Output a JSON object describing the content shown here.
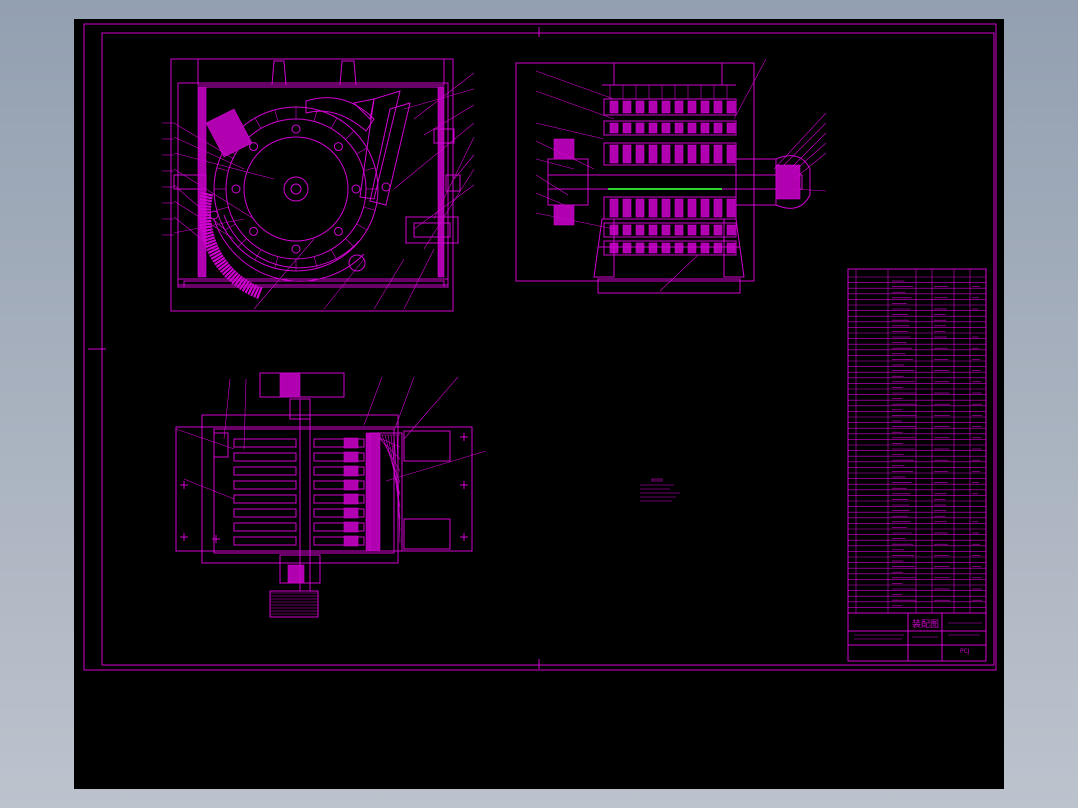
{
  "title_block": {
    "assembly_title": "装配图",
    "drawing_code": "PCJ"
  },
  "colors": {
    "background": "#000000",
    "line": "#d000d0",
    "accent": "#2fd52f",
    "frame_outside": "#a8b2bf"
  },
  "views": [
    "front-section-view",
    "side-section-view",
    "top-view"
  ]
}
